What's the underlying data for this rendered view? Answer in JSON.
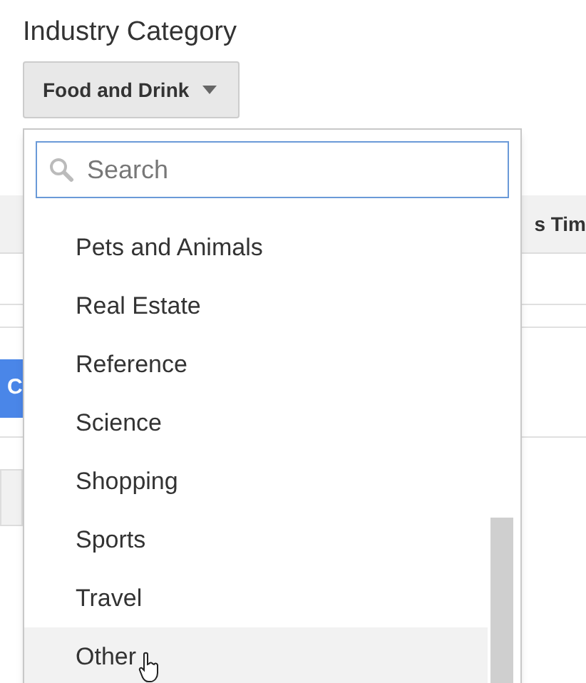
{
  "field_label": "Industry Category",
  "dropdown": {
    "value": "Food and Drink",
    "expanded": true,
    "search": {
      "placeholder": "Search"
    },
    "options": [
      {
        "label": "Pets and Animals",
        "hovered": false
      },
      {
        "label": "Real Estate",
        "hovered": false
      },
      {
        "label": "Reference",
        "hovered": false
      },
      {
        "label": "Science",
        "hovered": false
      },
      {
        "label": "Shopping",
        "hovered": false
      },
      {
        "label": "Sports",
        "hovered": false
      },
      {
        "label": "Travel",
        "hovered": false
      },
      {
        "label": "Other",
        "hovered": true
      }
    ]
  },
  "background": {
    "column_header": "s Tim",
    "button": "C"
  }
}
